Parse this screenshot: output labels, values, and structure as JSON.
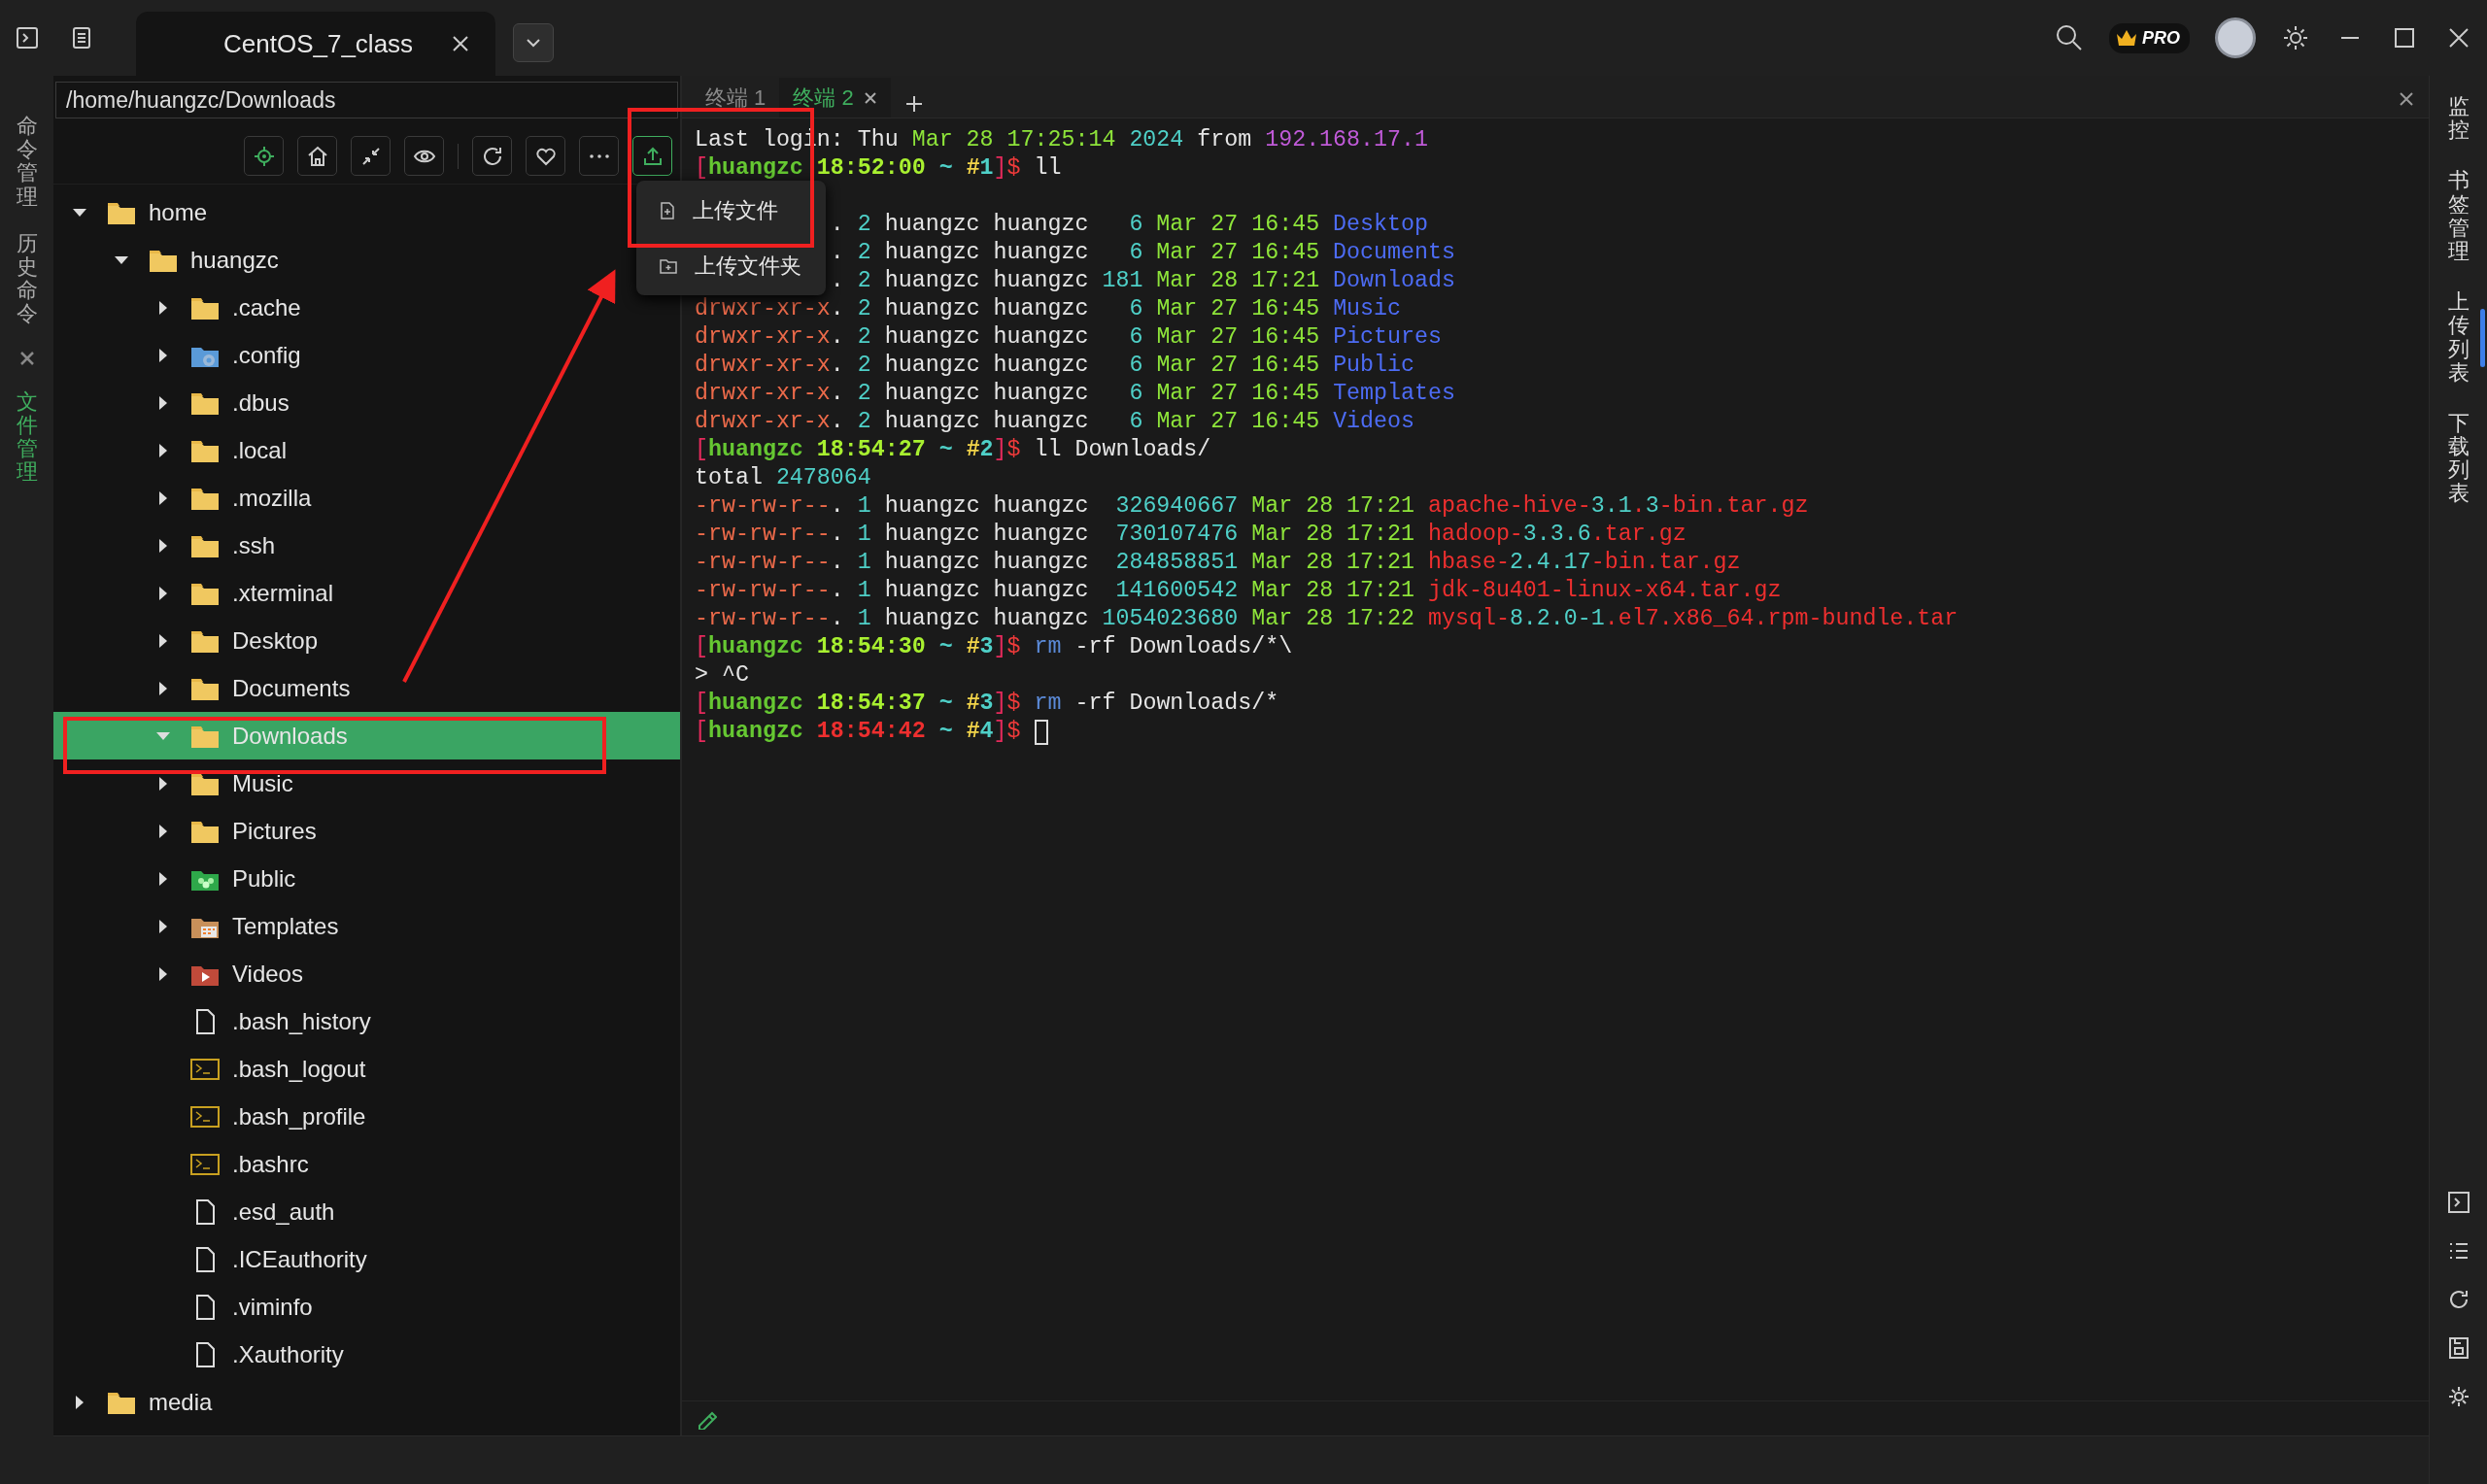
{
  "title_bar": {
    "tab": {
      "title": "CentOS_7_class",
      "selected": true
    },
    "badge": "PRO"
  },
  "left_sidebar": {
    "items": [
      {
        "label": "命令管理",
        "selected": false
      },
      {
        "label": "历史命令",
        "selected": false
      },
      {
        "label": "文件管理",
        "selected": true
      }
    ]
  },
  "file_panel": {
    "path": "/home/huangzc/Downloads",
    "tree": [
      {
        "name": "home",
        "kind": "folder",
        "expanded": true,
        "selected": false,
        "children": [
          {
            "name": "huangzc",
            "kind": "folder",
            "expanded": true,
            "selected": false,
            "children": [
              {
                "name": ".cache",
                "kind": "folder",
                "expanded": false,
                "selected": false
              },
              {
                "name": ".config",
                "kind": "config",
                "expanded": false,
                "selected": false
              },
              {
                "name": ".dbus",
                "kind": "folder",
                "expanded": false,
                "selected": false
              },
              {
                "name": ".local",
                "kind": "folder",
                "expanded": false,
                "selected": false
              },
              {
                "name": ".mozilla",
                "kind": "folder",
                "expanded": false,
                "selected": false
              },
              {
                "name": ".ssh",
                "kind": "folder",
                "expanded": false,
                "selected": false
              },
              {
                "name": ".xterminal",
                "kind": "folder",
                "expanded": false,
                "selected": false
              },
              {
                "name": "Desktop",
                "kind": "folder",
                "expanded": false,
                "selected": false
              },
              {
                "name": "Documents",
                "kind": "folder",
                "expanded": false,
                "selected": false
              },
              {
                "name": "Downloads",
                "kind": "folder",
                "expanded": true,
                "selected": true
              },
              {
                "name": "Music",
                "kind": "folder",
                "expanded": false,
                "selected": false
              },
              {
                "name": "Pictures",
                "kind": "folder",
                "expanded": false,
                "selected": false
              },
              {
                "name": "Public",
                "kind": "public",
                "expanded": false,
                "selected": false
              },
              {
                "name": "Templates",
                "kind": "templates",
                "expanded": false,
                "selected": false
              },
              {
                "name": "Videos",
                "kind": "videos",
                "expanded": false,
                "selected": false
              },
              {
                "name": ".bash_history",
                "kind": "file",
                "selected": false
              },
              {
                "name": ".bash_logout",
                "kind": "script",
                "selected": false
              },
              {
                "name": ".bash_profile",
                "kind": "script",
                "selected": false
              },
              {
                "name": ".bashrc",
                "kind": "script",
                "selected": false
              },
              {
                "name": ".esd_auth",
                "kind": "file",
                "selected": false
              },
              {
                "name": ".ICEauthority",
                "kind": "file",
                "selected": false
              },
              {
                "name": ".viminfo",
                "kind": "file",
                "selected": false
              },
              {
                "name": ".Xauthority",
                "kind": "file",
                "selected": false
              }
            ]
          }
        ]
      },
      {
        "name": "media",
        "kind": "folder",
        "expanded": false,
        "selected": false
      }
    ]
  },
  "upload_menu": {
    "items": [
      {
        "label": "上传文件",
        "kind": "file"
      },
      {
        "label": "上传文件夹",
        "kind": "folder"
      }
    ]
  },
  "terminal": {
    "tabs": [
      {
        "label": "终端 1",
        "selected": false
      },
      {
        "label": "终端 2",
        "selected": true
      }
    ],
    "lines": [
      {
        "kind": "full",
        "segments": [
          {
            "t": "Last login: Thu ",
            "color": "#e6e6e6",
            "bold": false
          },
          {
            "t": "Mar 28 17:25:14 ",
            "color": "#8ee43a",
            "bold": false
          },
          {
            "t": "2024 ",
            "color": "#4fd0c8",
            "bold": false
          },
          {
            "t": "from ",
            "color": "#e6e6e6",
            "bold": false
          },
          {
            "t": "192.168.17.1",
            "color": "#c05ad8",
            "bold": false
          }
        ]
      },
      {
        "kind": "full",
        "segments": [
          {
            "t": "[",
            "color": "#e62a5c",
            "bold": false
          },
          {
            "t": "huangzc ",
            "color": "#66c832",
            "bold": true
          },
          {
            "t": "18:52:00",
            "color": "#a8f030",
            "bold": true
          },
          {
            "t": " ~ ",
            "color": "#4fd0c8",
            "bold": true
          },
          {
            "t": "#",
            "color": "#f2d44a",
            "bold": true
          },
          {
            "t": "1",
            "color": "#4fd0c8",
            "bold": true
          },
          {
            "t": "]",
            "color": "#e62a5c",
            "bold": false
          },
          {
            "t": "$",
            "color": "#ee3a3a",
            "bold": false
          },
          {
            "t": " ll",
            "color": "#e6e6e6",
            "bold": false
          }
        ]
      },
      {
        "kind": "hidden"
      },
      {
        "kind": "partial",
        "segments": [
          {
            "t": ". ",
            "color": "#e6e6e6",
            "bold": false
          },
          {
            "t": "2 ",
            "color": "#4fd0c8",
            "bold": false
          },
          {
            "t": "huangzc huangzc   ",
            "color": "#e6e6e6",
            "bold": false
          },
          {
            "t": "6 ",
            "color": "#4fd0c8",
            "bold": false
          },
          {
            "t": "Mar 27 16:45 ",
            "color": "#8ee43a",
            "bold": false
          },
          {
            "t": "Desktop",
            "color": "#4d6cf5",
            "bold": false
          }
        ]
      },
      {
        "kind": "partial",
        "segments": [
          {
            "t": ". ",
            "color": "#e6e6e6",
            "bold": false
          },
          {
            "t": "2 ",
            "color": "#4fd0c8",
            "bold": false
          },
          {
            "t": "huangzc huangzc   ",
            "color": "#e6e6e6",
            "bold": false
          },
          {
            "t": "6 ",
            "color": "#4fd0c8",
            "bold": false
          },
          {
            "t": "Mar 27 16:45 ",
            "color": "#8ee43a",
            "bold": false
          },
          {
            "t": "Documents",
            "color": "#4d6cf5",
            "bold": false
          }
        ]
      },
      {
        "kind": "partial",
        "segments": [
          {
            "t": ". ",
            "color": "#e6e6e6",
            "bold": false
          },
          {
            "t": "2 ",
            "color": "#4fd0c8",
            "bold": false
          },
          {
            "t": "huangzc huangzc ",
            "color": "#e6e6e6",
            "bold": false
          },
          {
            "t": "181 ",
            "color": "#4fd0c8",
            "bold": false
          },
          {
            "t": "Mar 28 17:21 ",
            "color": "#8ee43a",
            "bold": false
          },
          {
            "t": "Downloads",
            "color": "#4d6cf5",
            "bold": false
          }
        ]
      },
      {
        "kind": "full",
        "segments": [
          {
            "t": "drwxr-xr-x",
            "color": "#ec6a4a",
            "bold": false
          },
          {
            "t": ". ",
            "color": "#e6e6e6",
            "bold": false
          },
          {
            "t": "2 ",
            "color": "#4fd0c8",
            "bold": false
          },
          {
            "t": "huangzc huangzc   ",
            "color": "#e6e6e6",
            "bold": false
          },
          {
            "t": "6 ",
            "color": "#4fd0c8",
            "bold": false
          },
          {
            "t": "Mar 27 16:45 ",
            "color": "#8ee43a",
            "bold": false
          },
          {
            "t": "Music",
            "color": "#4d6cf5",
            "bold": false
          }
        ]
      },
      {
        "kind": "full",
        "segments": [
          {
            "t": "drwxr-xr-x",
            "color": "#ec6a4a",
            "bold": false
          },
          {
            "t": ". ",
            "color": "#e6e6e6",
            "bold": false
          },
          {
            "t": "2 ",
            "color": "#4fd0c8",
            "bold": false
          },
          {
            "t": "huangzc huangzc   ",
            "color": "#e6e6e6",
            "bold": false
          },
          {
            "t": "6 ",
            "color": "#4fd0c8",
            "bold": false
          },
          {
            "t": "Mar 27 16:45 ",
            "color": "#8ee43a",
            "bold": false
          },
          {
            "t": "Pictures",
            "color": "#4d6cf5",
            "bold": false
          }
        ]
      },
      {
        "kind": "full",
        "segments": [
          {
            "t": "drwxr-xr-x",
            "color": "#ec6a4a",
            "bold": false
          },
          {
            "t": ". ",
            "color": "#e6e6e6",
            "bold": false
          },
          {
            "t": "2 ",
            "color": "#4fd0c8",
            "bold": false
          },
          {
            "t": "huangzc huangzc   ",
            "color": "#e6e6e6",
            "bold": false
          },
          {
            "t": "6 ",
            "color": "#4fd0c8",
            "bold": false
          },
          {
            "t": "Mar 27 16:45 ",
            "color": "#8ee43a",
            "bold": false
          },
          {
            "t": "Public",
            "color": "#4d6cf5",
            "bold": false
          }
        ]
      },
      {
        "kind": "full",
        "segments": [
          {
            "t": "drwxr-xr-x",
            "color": "#ec6a4a",
            "bold": false
          },
          {
            "t": ". ",
            "color": "#e6e6e6",
            "bold": false
          },
          {
            "t": "2 ",
            "color": "#4fd0c8",
            "bold": false
          },
          {
            "t": "huangzc huangzc   ",
            "color": "#e6e6e6",
            "bold": false
          },
          {
            "t": "6 ",
            "color": "#4fd0c8",
            "bold": false
          },
          {
            "t": "Mar 27 16:45 ",
            "color": "#8ee43a",
            "bold": false
          },
          {
            "t": "Templates",
            "color": "#4d6cf5",
            "bold": false
          }
        ]
      },
      {
        "kind": "full",
        "segments": [
          {
            "t": "drwxr-xr-x",
            "color": "#ec6a4a",
            "bold": false
          },
          {
            "t": ". ",
            "color": "#e6e6e6",
            "bold": false
          },
          {
            "t": "2 ",
            "color": "#4fd0c8",
            "bold": false
          },
          {
            "t": "huangzc huangzc   ",
            "color": "#e6e6e6",
            "bold": false
          },
          {
            "t": "6 ",
            "color": "#4fd0c8",
            "bold": false
          },
          {
            "t": "Mar 27 16:45 ",
            "color": "#8ee43a",
            "bold": false
          },
          {
            "t": "Videos",
            "color": "#4d6cf5",
            "bold": false
          }
        ]
      },
      {
        "kind": "full",
        "segments": [
          {
            "t": "[",
            "color": "#e62a5c",
            "bold": false
          },
          {
            "t": "huangzc ",
            "color": "#66c832",
            "bold": true
          },
          {
            "t": "18:54:27",
            "color": "#a8f030",
            "bold": true
          },
          {
            "t": " ~ ",
            "color": "#4fd0c8",
            "bold": true
          },
          {
            "t": "#",
            "color": "#f2d44a",
            "bold": true
          },
          {
            "t": "2",
            "color": "#4fd0c8",
            "bold": true
          },
          {
            "t": "]",
            "color": "#e62a5c",
            "bold": false
          },
          {
            "t": "$",
            "color": "#ee3a3a",
            "bold": false
          },
          {
            "t": " ll Downloads/",
            "color": "#e6e6e6",
            "bold": false
          }
        ]
      },
      {
        "kind": "full",
        "segments": [
          {
            "t": "total ",
            "color": "#e6e6e6",
            "bold": false
          },
          {
            "t": "2478064",
            "color": "#4fd0c8",
            "bold": false
          }
        ]
      },
      {
        "kind": "full",
        "segments": [
          {
            "t": "-rw-rw-r--",
            "color": "#ec6a4a",
            "bold": false
          },
          {
            "t": ". ",
            "color": "#e6e6e6",
            "bold": false
          },
          {
            "t": "1 ",
            "color": "#4fd0c8",
            "bold": false
          },
          {
            "t": "huangzc huangzc  ",
            "color": "#e6e6e6",
            "bold": false
          },
          {
            "t": "326940667 ",
            "color": "#4fd0c8",
            "bold": false
          },
          {
            "t": "Mar 28 17:21 ",
            "color": "#8ee43a",
            "bold": false
          },
          {
            "t": "apache-hive-",
            "color": "#ee2f2f",
            "bold": false
          },
          {
            "t": "3.1",
            "color": "#4fd0c8",
            "bold": false
          },
          {
            "t": ".",
            "color": "#ee2f2f",
            "bold": false
          },
          {
            "t": "3",
            "color": "#4fd0c8",
            "bold": false
          },
          {
            "t": "-bin.tar.gz",
            "color": "#ee2f2f",
            "bold": false
          }
        ]
      },
      {
        "kind": "full",
        "segments": [
          {
            "t": "-rw-rw-r--",
            "color": "#ec6a4a",
            "bold": false
          },
          {
            "t": ". ",
            "color": "#e6e6e6",
            "bold": false
          },
          {
            "t": "1 ",
            "color": "#4fd0c8",
            "bold": false
          },
          {
            "t": "huangzc huangzc  ",
            "color": "#e6e6e6",
            "bold": false
          },
          {
            "t": "730107476 ",
            "color": "#4fd0c8",
            "bold": false
          },
          {
            "t": "Mar 28 17:21 ",
            "color": "#8ee43a",
            "bold": false
          },
          {
            "t": "hadoop-",
            "color": "#ee2f2f",
            "bold": false
          },
          {
            "t": "3.3.6",
            "color": "#4fd0c8",
            "bold": false
          },
          {
            "t": ".tar.gz",
            "color": "#ee2f2f",
            "bold": false
          }
        ]
      },
      {
        "kind": "full",
        "segments": [
          {
            "t": "-rw-rw-r--",
            "color": "#ec6a4a",
            "bold": false
          },
          {
            "t": ". ",
            "color": "#e6e6e6",
            "bold": false
          },
          {
            "t": "1 ",
            "color": "#4fd0c8",
            "bold": false
          },
          {
            "t": "huangzc huangzc  ",
            "color": "#e6e6e6",
            "bold": false
          },
          {
            "t": "284858851 ",
            "color": "#4fd0c8",
            "bold": false
          },
          {
            "t": "Mar 28 17:21 ",
            "color": "#8ee43a",
            "bold": false
          },
          {
            "t": "hbase-",
            "color": "#ee2f2f",
            "bold": false
          },
          {
            "t": "2.4.17",
            "color": "#4fd0c8",
            "bold": false
          },
          {
            "t": "-bin.tar.gz",
            "color": "#ee2f2f",
            "bold": false
          }
        ]
      },
      {
        "kind": "full",
        "segments": [
          {
            "t": "-rw-rw-r--",
            "color": "#ec6a4a",
            "bold": false
          },
          {
            "t": ". ",
            "color": "#e6e6e6",
            "bold": false
          },
          {
            "t": "1 ",
            "color": "#4fd0c8",
            "bold": false
          },
          {
            "t": "huangzc huangzc  ",
            "color": "#e6e6e6",
            "bold": false
          },
          {
            "t": "141600542 ",
            "color": "#4fd0c8",
            "bold": false
          },
          {
            "t": "Mar 28 17:21 ",
            "color": "#8ee43a",
            "bold": false
          },
          {
            "t": "jdk-8u401-linux-x64.tar.gz",
            "color": "#ee2f2f",
            "bold": false
          }
        ]
      },
      {
        "kind": "full",
        "segments": [
          {
            "t": "-rw-rw-r--",
            "color": "#ec6a4a",
            "bold": false
          },
          {
            "t": ". ",
            "color": "#e6e6e6",
            "bold": false
          },
          {
            "t": "1 ",
            "color": "#4fd0c8",
            "bold": false
          },
          {
            "t": "huangzc huangzc ",
            "color": "#e6e6e6",
            "bold": false
          },
          {
            "t": "1054023680 ",
            "color": "#4fd0c8",
            "bold": false
          },
          {
            "t": "Mar 28 17:22 ",
            "color": "#8ee43a",
            "bold": false
          },
          {
            "t": "mysql-",
            "color": "#ee2f2f",
            "bold": false
          },
          {
            "t": "8.2.0-1",
            "color": "#4fd0c8",
            "bold": false
          },
          {
            "t": ".el7.x86_64.rpm-bundle.tar",
            "color": "#ee2f2f",
            "bold": false
          }
        ]
      },
      {
        "kind": "full",
        "segments": [
          {
            "t": "[",
            "color": "#e62a5c",
            "bold": false
          },
          {
            "t": "huangzc ",
            "color": "#66c832",
            "bold": true
          },
          {
            "t": "18:54:30",
            "color": "#a8f030",
            "bold": true
          },
          {
            "t": " ~ ",
            "color": "#4fd0c8",
            "bold": true
          },
          {
            "t": "#",
            "color": "#f2d44a",
            "bold": true
          },
          {
            "t": "3",
            "color": "#4fd0c8",
            "bold": true
          },
          {
            "t": "]",
            "color": "#e62a5c",
            "bold": false
          },
          {
            "t": "$",
            "color": "#ee3a3a",
            "bold": false
          },
          {
            "t": " rm",
            "color": "#5b8ad8",
            "bold": false
          },
          {
            "t": " -rf Downloads/*\\",
            "color": "#e6e6e6",
            "bold": false
          }
        ]
      },
      {
        "kind": "full",
        "segments": [
          {
            "t": "> ^C",
            "color": "#e6e6e6",
            "bold": false
          }
        ]
      },
      {
        "kind": "full",
        "segments": [
          {
            "t": "[",
            "color": "#e62a5c",
            "bold": false
          },
          {
            "t": "huangzc ",
            "color": "#66c832",
            "bold": true
          },
          {
            "t": "18:54:37",
            "color": "#a8f030",
            "bold": true
          },
          {
            "t": " ~ ",
            "color": "#4fd0c8",
            "bold": true
          },
          {
            "t": "#",
            "color": "#f2d44a",
            "bold": true
          },
          {
            "t": "3",
            "color": "#4fd0c8",
            "bold": true
          },
          {
            "t": "]",
            "color": "#e62a5c",
            "bold": false
          },
          {
            "t": "$",
            "color": "#ee3a3a",
            "bold": false
          },
          {
            "t": " rm",
            "color": "#5b8ad8",
            "bold": false
          },
          {
            "t": " -rf Downloads/*",
            "color": "#e6e6e6",
            "bold": false
          }
        ]
      },
      {
        "kind": "full",
        "cursor": true,
        "segments": [
          {
            "t": "[",
            "color": "#e62a5c",
            "bold": false
          },
          {
            "t": "huangzc ",
            "color": "#66c832",
            "bold": true
          },
          {
            "t": "18:54:42",
            "color": "#ee2f2f",
            "bold": true
          },
          {
            "t": " ~ ",
            "color": "#4fd0c8",
            "bold": true
          },
          {
            "t": "#",
            "color": "#f2d44a",
            "bold": true
          },
          {
            "t": "4",
            "color": "#4fd0c8",
            "bold": true
          },
          {
            "t": "]",
            "color": "#e62a5c",
            "bold": false
          },
          {
            "t": "$",
            "color": "#ee3a3a",
            "bold": false
          }
        ]
      }
    ]
  },
  "right_sidebar": {
    "items": [
      {
        "label": "监控"
      },
      {
        "label": "书签管理"
      },
      {
        "label": "上传列表"
      },
      {
        "label": "下载列表"
      }
    ]
  }
}
